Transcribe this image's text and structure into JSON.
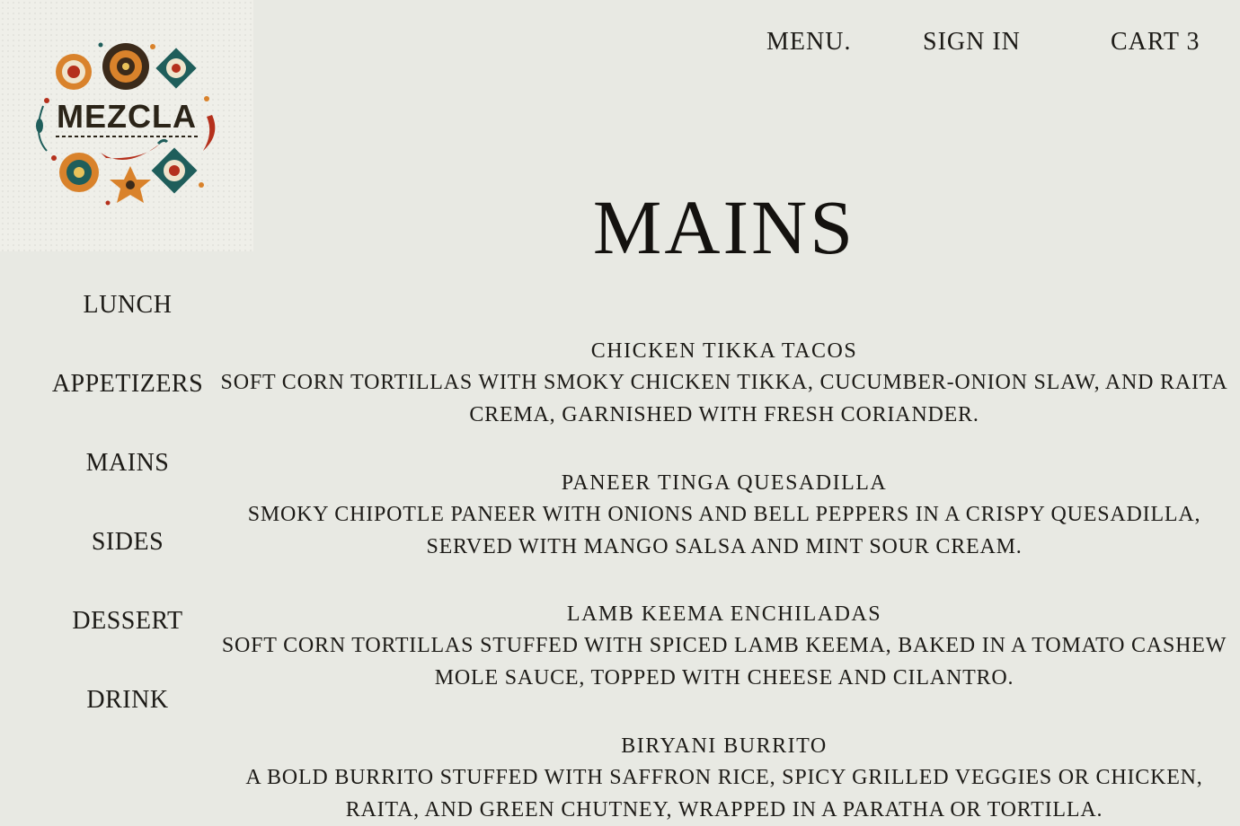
{
  "logo": {
    "text": "MEZCLA"
  },
  "nav": {
    "menu": "MENU.",
    "sign_in": "SIGN IN",
    "cart": "CART 3"
  },
  "page_title": "MAINS",
  "sidebar": {
    "items": [
      {
        "label": "LUNCH"
      },
      {
        "label": "APPETIZERS"
      },
      {
        "label": "MAINS"
      },
      {
        "label": "SIDES"
      },
      {
        "label": "DESSERT"
      },
      {
        "label": "DRINK"
      }
    ]
  },
  "menu_items": [
    {
      "name": "CHICKEN TIKKA TACOS",
      "description": "SOFT CORN TORTILLAS WITH SMOKY CHICKEN TIKKA, CUCUMBER-ONION SLAW, AND RAITA CREMA, GARNISHED WITH FRESH CORIANDER."
    },
    {
      "name": "PANEER TINGA QUESADILLA",
      "description": "SMOKY CHIPOTLE PANEER WITH ONIONS AND BELL PEPPERS IN A CRISPY QUESADILLA, SERVED WITH MANGO SALSA AND MINT SOUR CREAM."
    },
    {
      "name": "LAMB KEEMA ENCHILADAS",
      "description": "SOFT CORN TORTILLAS STUFFED WITH SPICED LAMB KEEMA, BAKED IN A TOMATO CASHEW MOLE SAUCE, TOPPED WITH CHEESE AND CILANTRO."
    },
    {
      "name": "BIRYANI BURRITO",
      "description": "A BOLD BURRITO STUFFED WITH SAFFRON RICE, SPICY GRILLED VEGGIES OR CHICKEN, RAITA, AND GREEN CHUTNEY, WRAPPED IN A PARATHA OR TORTILLA."
    }
  ],
  "colors": {
    "background": "#e8e9e3",
    "text": "#1d1b17",
    "logo_orange": "#d9822b",
    "logo_teal": "#1f5e5b",
    "logo_red": "#b5301c"
  },
  "icons": [
    "mezcla-logo",
    "chili-pepper-icon",
    "mandala-icon"
  ]
}
